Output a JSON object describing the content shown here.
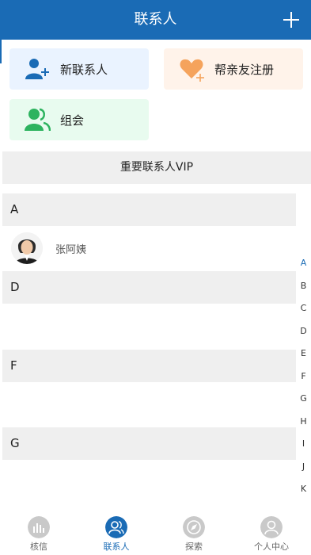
{
  "header": {
    "title": "联系人"
  },
  "actions": {
    "new_contact": "新联系人",
    "help_register": "帮亲友注册",
    "group": "组会"
  },
  "vip_label": "重要联系人VIP",
  "sections": [
    {
      "letter": "A",
      "contacts": [
        {
          "name": "张阿姨"
        }
      ]
    },
    {
      "letter": "D",
      "contacts": []
    },
    {
      "letter": "F",
      "contacts": []
    },
    {
      "letter": "G",
      "contacts": []
    }
  ],
  "index_letters": [
    "A",
    "B",
    "C",
    "D",
    "E",
    "F",
    "G",
    "H",
    "I",
    "J",
    "K"
  ],
  "active_index": "A",
  "tabs": [
    {
      "label": "核信",
      "icon": "chart-wave-icon"
    },
    {
      "label": "联系人",
      "icon": "contacts-icon"
    },
    {
      "label": "探索",
      "icon": "compass-icon"
    },
    {
      "label": "个人中心",
      "icon": "user-icon"
    }
  ],
  "active_tab": "联系人",
  "colors": {
    "primary": "#1a6bb5",
    "new_bg": "#eaf3ff",
    "help_bg": "#fff3ea",
    "group_bg": "#e8fbef",
    "help_heart": "#f5a35c",
    "group_green": "#2db35f"
  }
}
